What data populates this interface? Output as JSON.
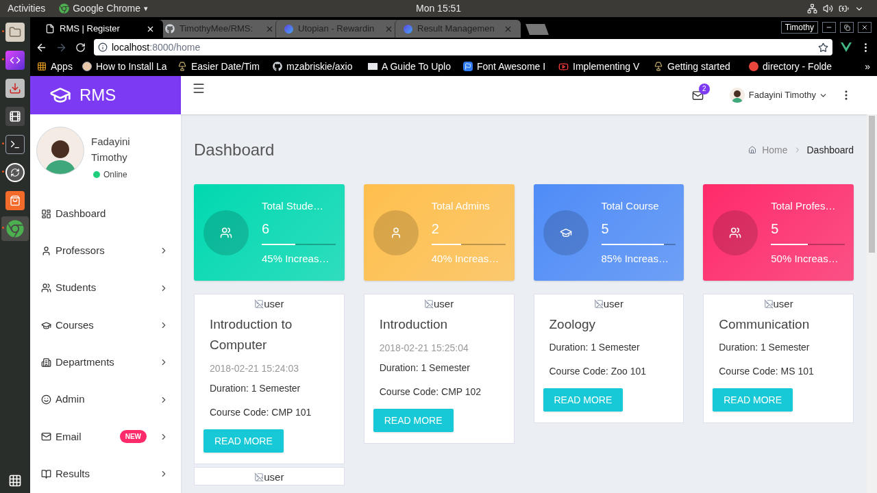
{
  "desktop_bar": {
    "activities": "Activities",
    "app_name": "Google Chrome",
    "app_menu_caret": "▾",
    "clock": "Mon 15:51"
  },
  "dock": [
    {
      "kind": "files",
      "running": true,
      "selected": false
    },
    {
      "kind": "ide",
      "running": true,
      "selected": false
    },
    {
      "kind": "installer",
      "running": false,
      "selected": false
    },
    {
      "kind": "video",
      "running": false,
      "selected": false
    },
    {
      "kind": "terminal",
      "running": true,
      "selected": false
    },
    {
      "kind": "updater",
      "running": true,
      "selected": false
    },
    {
      "kind": "store",
      "running": false,
      "selected": false
    },
    {
      "kind": "chrome",
      "running": true,
      "selected": true
    }
  ],
  "browser": {
    "tabs": [
      {
        "title": "RMS | Register",
        "kind": "page",
        "selected": true
      },
      {
        "title": "TimothyMee/RMS:",
        "kind": "github",
        "selected": false
      },
      {
        "title": "Utopian - Rewardin",
        "kind": "utopian",
        "selected": false
      },
      {
        "title": "Result Managemen",
        "kind": "utopian",
        "selected": false
      }
    ],
    "profile": "Timothy",
    "address": {
      "host": "localhost",
      "rest": ":8000/home"
    },
    "bookmarks": [
      {
        "title": "Apps",
        "kind": "apps"
      },
      {
        "title": "How to Install La",
        "kind": "circle"
      },
      {
        "title": "Easier Date/Tim",
        "kind": "lamp"
      },
      {
        "title": "mzabriskie/axio",
        "kind": "github"
      },
      {
        "title": "A Guide To Uplo",
        "kind": "aw"
      },
      {
        "title": "Font Awesome I",
        "kind": "flag"
      },
      {
        "title": "Implementing V",
        "kind": "youtube"
      },
      {
        "title": "Getting started",
        "kind": "lamp"
      },
      {
        "title": "directory - Folde",
        "kind": "ask"
      }
    ],
    "more_bookmarks": "»"
  },
  "app": {
    "brand": "RMS",
    "user": {
      "first_name": "Fadayini",
      "last_name": "Timothy",
      "status": "Online",
      "full_name": "Fadayini Timothy"
    },
    "mail_badge": "2",
    "menu": [
      {
        "label": "Dashboard",
        "kind": "dashboard",
        "has_submenu": false
      },
      {
        "label": "Professors",
        "kind": "person",
        "has_submenu": true
      },
      {
        "label": "Students",
        "kind": "people",
        "has_submenu": true
      },
      {
        "label": "Courses",
        "kind": "school",
        "has_submenu": true
      },
      {
        "label": "Departments",
        "kind": "building",
        "has_submenu": true
      },
      {
        "label": "Admin",
        "kind": "face",
        "has_submenu": true
      },
      {
        "label": "Email",
        "kind": "mail",
        "has_submenu": true,
        "badge": "NEW"
      },
      {
        "label": "Results",
        "kind": "book",
        "has_submenu": true
      }
    ],
    "page_title": "Dashboard",
    "breadcrumb": [
      {
        "label": "Home",
        "current": false
      },
      {
        "label": "Dashboard",
        "current": true
      }
    ],
    "stats": [
      {
        "title": "Total Stude…",
        "value": "6",
        "note": "45% Increas…",
        "level": 0.45,
        "kind": "people",
        "color": "#00d9b0"
      },
      {
        "title": "Total Admins",
        "value": "2",
        "note": "40% Increas…",
        "level": 0.4,
        "kind": "person",
        "color": "#ffbf4d"
      },
      {
        "title": "Total Course",
        "value": "5",
        "note": "85% Increas…",
        "level": 0.85,
        "kind": "school",
        "color": "#4f8cf7"
      },
      {
        "title": "Total Profes…",
        "value": "5",
        "note": "50% Increas…",
        "level": 0.5,
        "kind": "people",
        "color": "#ff2a6a"
      }
    ],
    "courses": [
      {
        "image_alt": "user",
        "title": "Introduction to Computer",
        "date": "2018-02-21 15:24:03",
        "duration": "Duration: 1 Semester",
        "code": "Course Code: CMP 101",
        "button": "READ MORE"
      },
      {
        "image_alt": "user",
        "title": "Introduction",
        "date": "2018-02-21 15:25:04",
        "duration": "Duration: 1 Semester",
        "code": "Course Code: CMP 102",
        "button": "READ MORE"
      },
      {
        "image_alt": "user",
        "title": "Zoology",
        "duration": "Duration: 1 Semester",
        "code": "Course Code: Zoo 101",
        "button": "READ MORE"
      },
      {
        "image_alt": "user",
        "title": "Communication",
        "duration": "Duration: 1 Semester",
        "code": "Course Code: MS 101",
        "button": "READ MORE"
      },
      {
        "image_alt": "user"
      }
    ]
  }
}
